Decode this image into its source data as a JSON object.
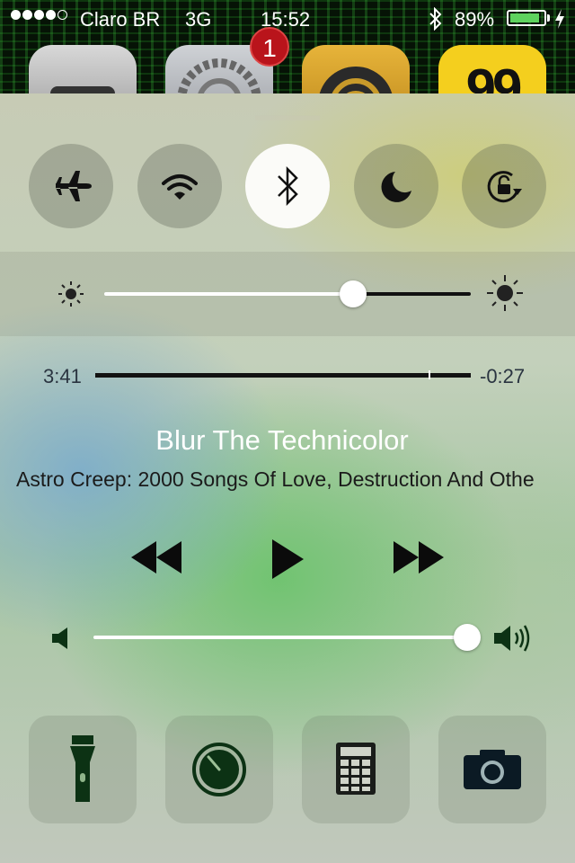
{
  "status_bar": {
    "signal_bars_filled": 4,
    "signal_bars_total": 5,
    "carrier": "Claro BR",
    "network": "3G",
    "time": "15:52",
    "bluetooth_icon": "bluetooth-icon",
    "battery_percent_label": "89%",
    "battery_level": 0.89,
    "charging_icon": "bolt-icon"
  },
  "home_screen": {
    "badge_count": "1",
    "icons": [
      "camera-icon",
      "settings-gear-icon",
      "wifi-app-icon",
      "99-taxi-icon"
    ],
    "app_99_label": "99"
  },
  "control_center": {
    "toggles": [
      {
        "name": "airplane-mode",
        "icon": "airplane-icon",
        "active": false
      },
      {
        "name": "wifi",
        "icon": "wifi-icon",
        "active": false
      },
      {
        "name": "bluetooth",
        "icon": "bluetooth-icon",
        "active": true
      },
      {
        "name": "do-not-disturb",
        "icon": "moon-icon",
        "active": false
      },
      {
        "name": "rotation-lock",
        "icon": "rotation-lock-icon",
        "active": false
      }
    ],
    "brightness": {
      "level": 0.68,
      "low_icon": "sun-small-icon",
      "high_icon": "sun-large-icon"
    },
    "now_playing": {
      "elapsed": "3:41",
      "remaining": "-0:27",
      "progress": 0.89,
      "title": "Blur The Technicolor",
      "artist_album": "Astro Creep: 2000 Songs Of Love, Destruction And Othe"
    },
    "transport": {
      "previous_icon": "rewind-icon",
      "play_icon": "play-icon",
      "next_icon": "fast-forward-icon"
    },
    "volume": {
      "level": 1.0,
      "low_icon": "speaker-low-icon",
      "high_icon": "speaker-high-icon"
    },
    "shortcuts": [
      {
        "name": "flashlight",
        "icon": "flashlight-icon"
      },
      {
        "name": "timer",
        "icon": "timer-icon"
      },
      {
        "name": "calculator",
        "icon": "calculator-icon"
      },
      {
        "name": "camera",
        "icon": "camera-icon"
      }
    ],
    "accent_colors": {
      "dark_green": "#0c3214",
      "icon_dark": "#111111",
      "scrubber": "#121212"
    }
  }
}
